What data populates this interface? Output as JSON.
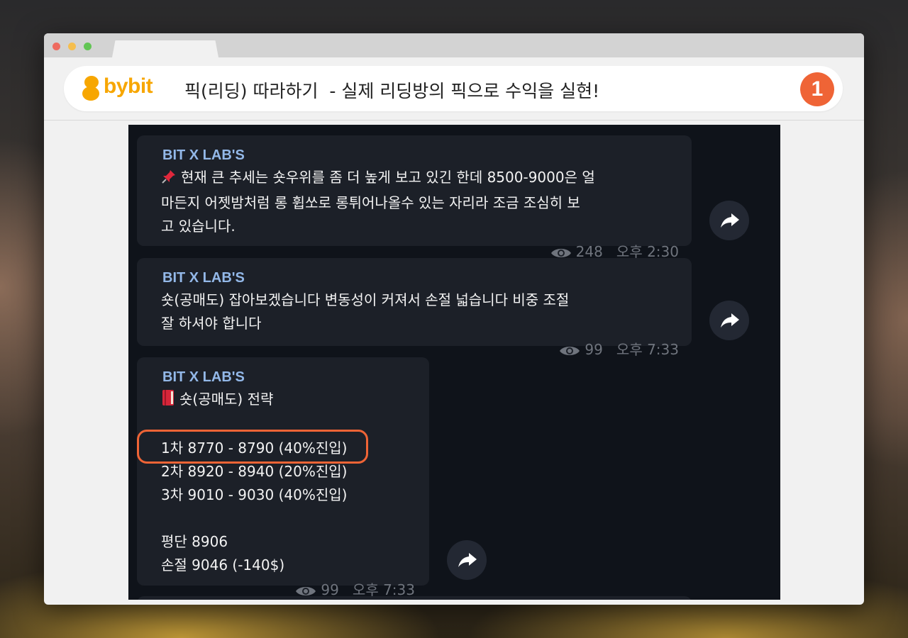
{
  "browser": {
    "brand": "bybit",
    "title": "픽(리딩) 따라하기  - 실제 리딩방의 픽으로 수익을 실현!",
    "step_number": "1"
  },
  "messages": [
    {
      "sender": "BIT X LAB'S",
      "lines": [
        "현재 큰 추세는 숏우위를 좀 더 높게 보고 있긴 한데 8500-9000은 얼",
        "마든지 어젯밤처럼 롱 휩쏘로 롱튀어나올수 있는 자리라 조금 조심히 보",
        "고 있습니다."
      ],
      "views": "248",
      "time": "오후 2:30",
      "icon": "pin-icon"
    },
    {
      "sender": "BIT X LAB'S",
      "lines": [
        "숏(공매도) 잡아보겠습니다 변동성이 커져서 손절 넓습니다 비중 조절",
        "잘 하셔야 합니다"
      ],
      "views": "99",
      "time": "오후 7:33"
    },
    {
      "sender": "BIT X LAB'S",
      "lines": [
        "숏(공매도) 전략",
        "",
        "1차 8770 - 8790 (40%진입)",
        "2차 8920 - 8940 (20%진입)",
        "3차 9010 - 9030 (40%진입)",
        "",
        "평단 8906",
        "손절 9046 (-140$)"
      ],
      "views": "99",
      "time": "오후 7:33",
      "icon": "book-icon"
    }
  ],
  "colors": {
    "accent": "#ef6436",
    "brand": "#f7a600",
    "sender": "#93b8e8",
    "bubble": "#1c2028",
    "chat_bg": "#0f131a"
  }
}
